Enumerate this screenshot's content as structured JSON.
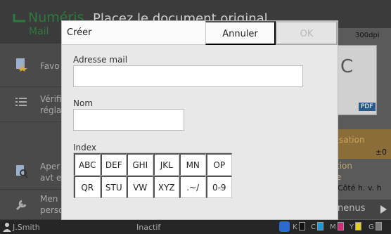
{
  "background": {
    "header": {
      "title": "Numéris",
      "subtitle": "Mail",
      "instruction": "Placez le document original"
    },
    "sidebar": {
      "items": [
        {
          "label": "Favo",
          "icon": "favorite-doc-icon"
        },
        {
          "label": "Vérifi\nréglag",
          "icon": "list-icon"
        },
        {
          "label": "Aper\navt en",
          "icon": "preview-magnifier-icon"
        },
        {
          "label": "Men\nperso",
          "icon": "wrench-icon"
        }
      ]
    },
    "right_panel": {
      "dpi": "300dpi",
      "preview_letter": "C",
      "pdf_badge": "PDF",
      "density_title": "sation",
      "density_value": "±0",
      "orientation_title": "tion\ne",
      "orientation_value": "Côté h. v. h",
      "menus_label": "nenus"
    }
  },
  "statusbar": {
    "user": "J.Smith",
    "state": "Inactif",
    "inks": [
      "K",
      "C",
      "M",
      "Y",
      "G"
    ]
  },
  "dialog": {
    "title": "Créer",
    "cancel_label": "Annuler",
    "ok_label": "OK",
    "email": {
      "label": "Adresse mail",
      "value": ""
    },
    "name": {
      "label": "Nom",
      "value": ""
    },
    "index": {
      "label": "Index",
      "keys": [
        "ABC",
        "DEF",
        "GHI",
        "JKL",
        "MN",
        "OP",
        "QR",
        "STU",
        "VW",
        "XYZ",
        ".~/",
        "0-9"
      ]
    }
  },
  "colors": {
    "accent_green": "#2c7a3d",
    "ink_k": "#111111",
    "ink_c": "#1a9ad6",
    "ink_m": "#d6287d",
    "ink_y": "#e6cf1a",
    "ink_g": "#7a7a7a"
  }
}
